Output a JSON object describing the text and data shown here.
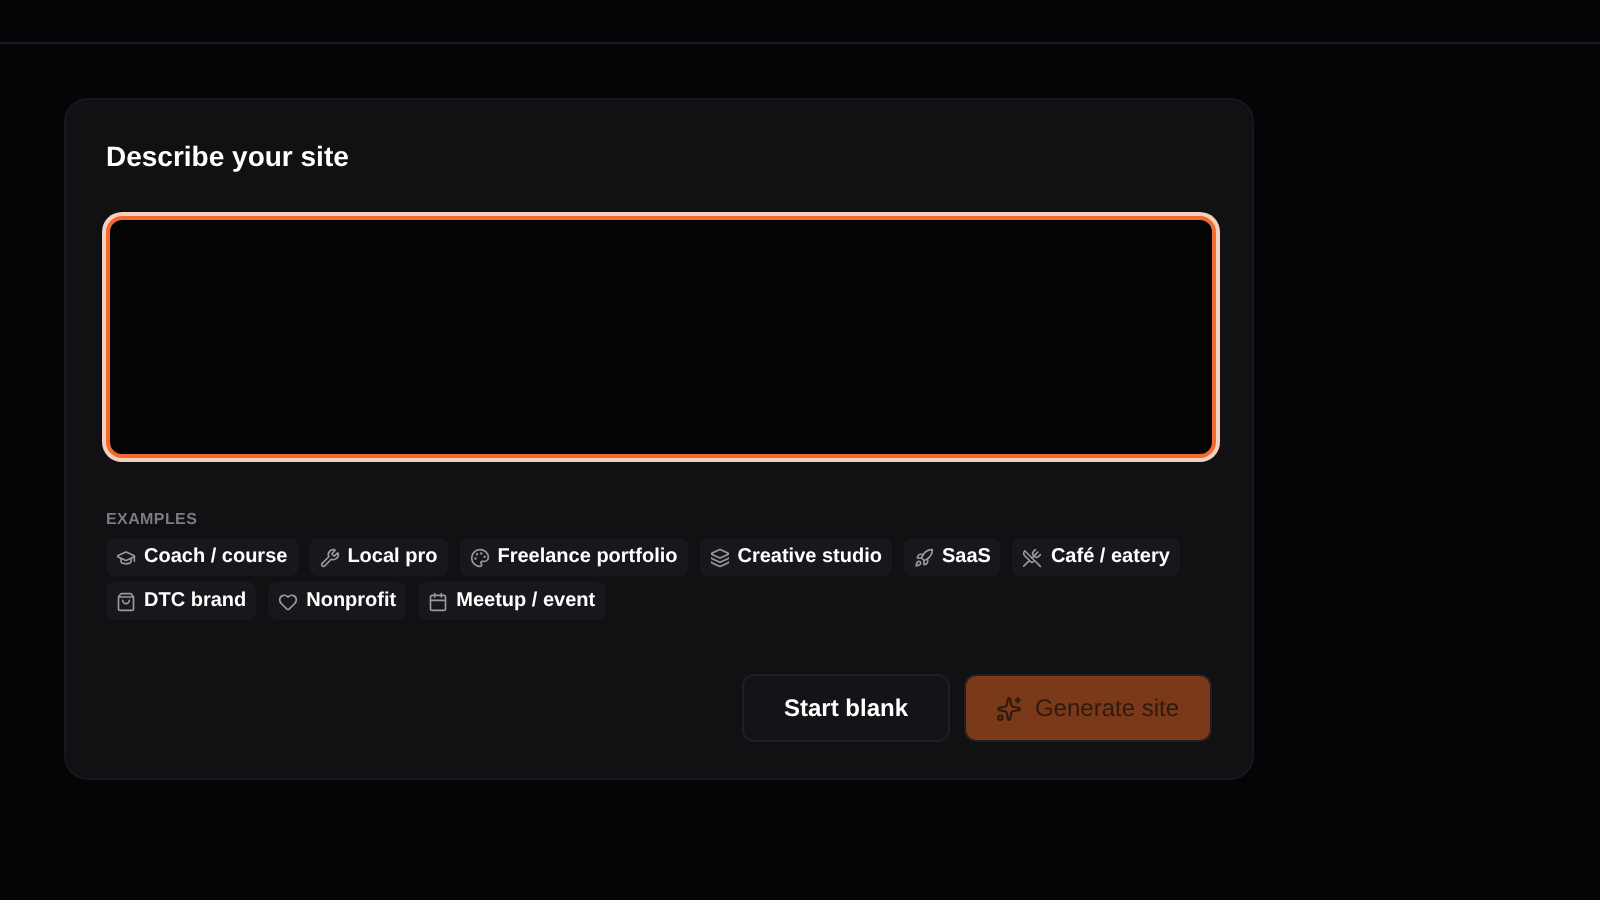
{
  "card": {
    "title": "Describe your site",
    "prompt": {
      "focused": true
    },
    "examples_label": "EXAMPLES",
    "examples": [
      {
        "label": "Coach / course"
      },
      {
        "label": "Local pro"
      },
      {
        "label": "Freelance portfolio"
      },
      {
        "label": "Creative studio"
      },
      {
        "label": "SaaS"
      },
      {
        "label": "Café / eatery"
      },
      {
        "label": "DTC brand"
      },
      {
        "label": "Nonprofit"
      },
      {
        "label": "Meetup / event"
      }
    ],
    "buttons": [
      {
        "label": "Start blank",
        "kind": "secondary",
        "disabled": false
      },
      {
        "label": "Generate site",
        "kind": "primary",
        "disabled": true
      }
    ]
  }
}
